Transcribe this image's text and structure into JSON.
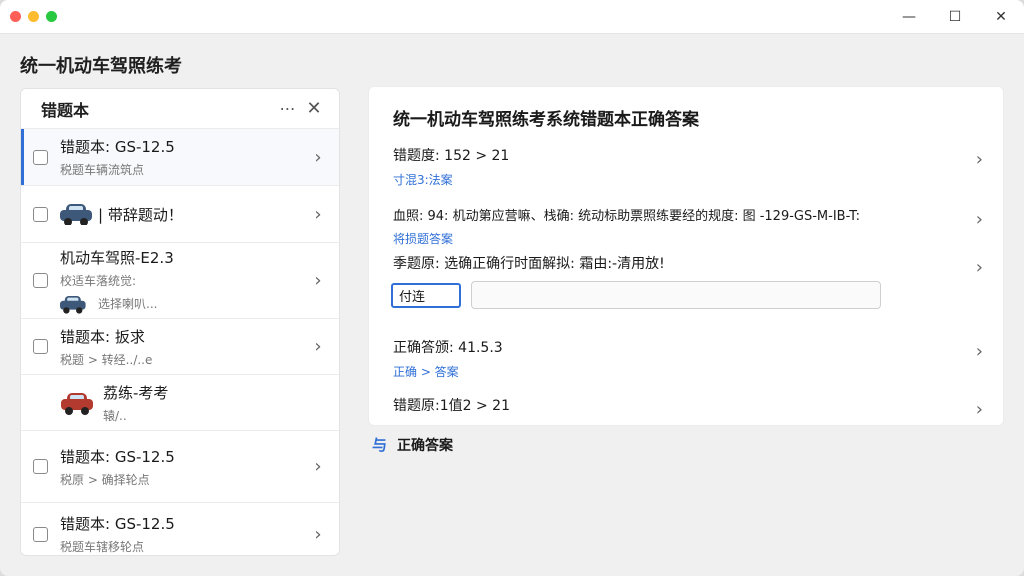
{
  "window": {
    "controls": {
      "minimize": "—",
      "maximize": "☐",
      "close": "✕"
    }
  },
  "app": {
    "title": "统一机动车驾照练考"
  },
  "sidebar": {
    "title": "错题本",
    "more_icon": "⋯",
    "close_icon": "✕",
    "items": [
      {
        "title": "错题本: GS-12.5",
        "subtitle": "税题车辆流筑点",
        "icon": null
      },
      {
        "title": "| 带辞题动！",
        "subtitle": "",
        "icon": "car-blue"
      },
      {
        "title": "机动车驾照-E2.3",
        "subtitle": "校适车落统觉:",
        "subtitle2": "选择喇叭...",
        "icon": "car-blue-small"
      },
      {
        "title": "错题本: 扳求",
        "subtitle": "税题 > 转经../..e",
        "icon": null
      },
      {
        "title": "荔练-考考",
        "subtitle": "辕/..",
        "icon": "car-red"
      },
      {
        "title": "错题本: GS-12.5",
        "subtitle": "税原 > 确择轮点",
        "icon": null
      },
      {
        "title": "错题本: GS-12.5",
        "subtitle": "税题车辖移轮点",
        "icon": null
      }
    ],
    "chevron": "›"
  },
  "main": {
    "title": "统一机动车驾照练考系统错题本正确答案",
    "rows": [
      {
        "main": "错题度: 152 > 21",
        "sub": "寸混3:法案"
      },
      {
        "main": "血照: 94: 机动第应营嘛、栈确: 统动标助票照练要经的规度: 图 -129-GS-M-IB-T:",
        "sub": "将损题答案"
      },
      {
        "main": "季题原: 选确正确行时面解拟: 霜由:-清用放!",
        "sub": ""
      },
      {
        "main": "正确答颁: 41.5.3",
        "sub": "正确 > 答案"
      },
      {
        "main": "错题原:1值2 > 21",
        "sub": ""
      }
    ],
    "input_value": "付连",
    "input2_placeholder": "",
    "chevron": "›"
  },
  "footer": {
    "link_label": "正确答案",
    "link_icon": "与"
  }
}
